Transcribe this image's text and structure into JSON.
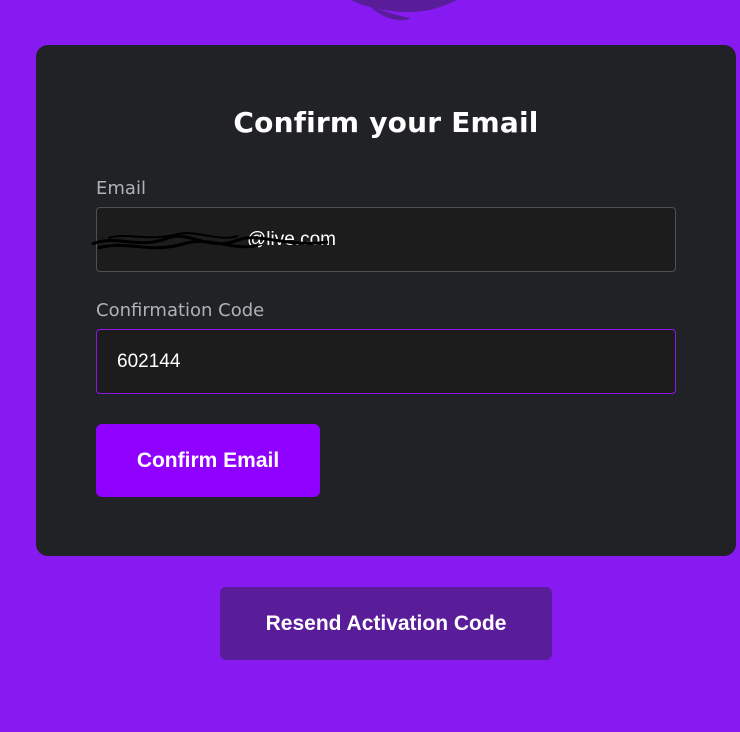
{
  "card": {
    "title": "Confirm your Email"
  },
  "email": {
    "label": "Email",
    "value": "@live.com"
  },
  "confirmation_code": {
    "label": "Confirmation Code",
    "value": "602144"
  },
  "buttons": {
    "confirm_label": "Confirm Email",
    "resend_label": "Resend Activation Code"
  },
  "colors": {
    "page_background": "#8719f1",
    "card_background": "#212226",
    "primary_button": "#8f00ff",
    "secondary_button": "#5a1d99",
    "focus_border": "#8f16e6"
  },
  "icons": {
    "logo": "speech-bubble-logo-icon"
  }
}
